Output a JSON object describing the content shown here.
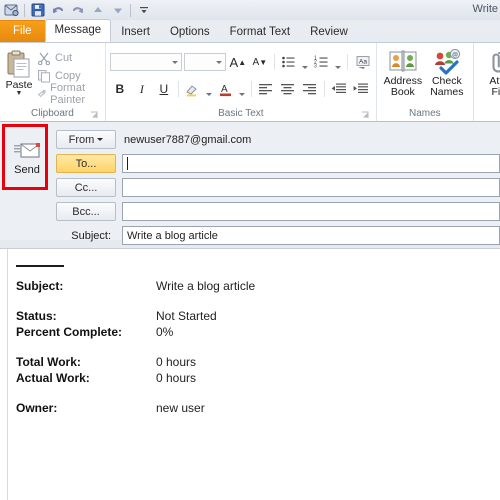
{
  "window": {
    "title": "Write"
  },
  "quick_access": {
    "items": [
      {
        "name": "office-icon",
        "glyph": "✉"
      },
      {
        "name": "save-icon",
        "glyph": "ὋE"
      },
      {
        "name": "undo-icon",
        "glyph": "↶"
      },
      {
        "name": "redo-icon",
        "glyph": "↷"
      },
      {
        "name": "previous-item-icon",
        "glyph": "◆"
      },
      {
        "name": "next-item-icon",
        "glyph": "◆"
      },
      {
        "name": "customize-qat-icon",
        "glyph": "▼"
      }
    ]
  },
  "tabs": [
    {
      "label": "File",
      "kind": "file"
    },
    {
      "label": "Message",
      "kind": "active"
    },
    {
      "label": "Insert",
      "kind": "normal"
    },
    {
      "label": "Options",
      "kind": "normal"
    },
    {
      "label": "Format Text",
      "kind": "normal"
    },
    {
      "label": "Review",
      "kind": "normal"
    }
  ],
  "ribbon": {
    "clipboard": {
      "group_label": "Clipboard",
      "paste_label": "Paste",
      "commands": [
        {
          "label": "Cut",
          "icon": "scissors-icon",
          "enabled": false
        },
        {
          "label": "Copy",
          "icon": "copy-icon",
          "enabled": false
        },
        {
          "label": "Format Painter",
          "icon": "format-painter-icon",
          "enabled": false
        }
      ]
    },
    "basic_text": {
      "group_label": "Basic Text",
      "font_name": "",
      "font_size": "",
      "buttons": [
        {
          "label": "A",
          "name": "grow-font-icon"
        },
        {
          "label": "A",
          "name": "shrink-font-icon"
        },
        {
          "label": "B",
          "name": "bold-button"
        },
        {
          "label": "I",
          "name": "italic-button"
        },
        {
          "label": "U",
          "name": "underline-button"
        },
        {
          "label": "Text Highlight Color",
          "name": "highlight-color-button"
        },
        {
          "label": "Font Color",
          "name": "font-color-button"
        },
        {
          "label": "Bullets",
          "name": "bullets-button"
        },
        {
          "label": "Numbering",
          "name": "numbering-button"
        },
        {
          "label": "Change Case",
          "name": "change-case-button"
        },
        {
          "label": "Align Left",
          "name": "align-left-button"
        },
        {
          "label": "Center",
          "name": "align-center-button"
        },
        {
          "label": "Align Right",
          "name": "align-right-button"
        },
        {
          "label": "Decrease Indent",
          "name": "decrease-indent-button"
        },
        {
          "label": "Increase Indent",
          "name": "increase-indent-button"
        }
      ]
    },
    "names": {
      "group_label": "Names",
      "address_book": "Address\nBook",
      "address_book_line1": "Address",
      "address_book_line2": "Book",
      "check_names_line1": "Check",
      "check_names_line2": "Names"
    },
    "include": {
      "attach_file_line1": "Att",
      "attach_file_line2": "Fi"
    }
  },
  "header": {
    "send_label": "Send",
    "from_label": "From",
    "from_value": "newuser7887@gmail.com",
    "to_label": "To...",
    "to_value": "",
    "cc_label": "Cc...",
    "cc_value": "",
    "bcc_label": "Bcc...",
    "bcc_value": "",
    "subject_label": "Subject:",
    "subject_value": "Write a blog article"
  },
  "body": {
    "rows": [
      {
        "key": "Subject:",
        "value": "Write a blog article"
      },
      {
        "key": "Status:",
        "value": "Not Started"
      },
      {
        "key": "Percent Complete:",
        "value": "0%"
      },
      {
        "key": "Total Work:",
        "value": "0 hours"
      },
      {
        "key": "Actual Work:",
        "value": "0 hours"
      },
      {
        "key": "Owner:",
        "value": "new user"
      }
    ]
  },
  "colors": {
    "file_tab": "#ee8f10",
    "highlight_box": "#e8000d",
    "to_button": "#ffd366",
    "ribbon_bg": "#ffffff"
  }
}
